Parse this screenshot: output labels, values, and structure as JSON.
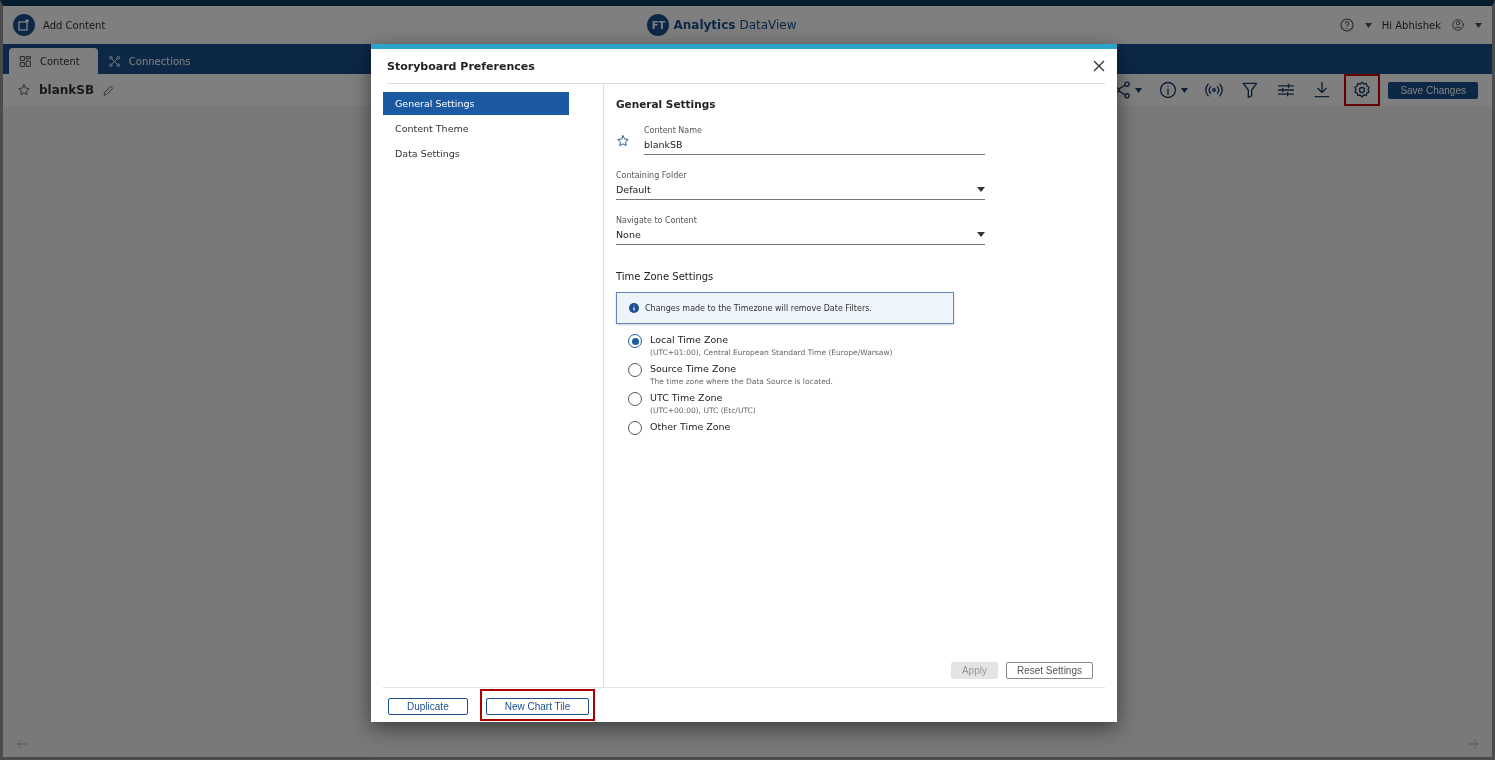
{
  "header": {
    "add_content": "Add Content",
    "logo_badge": "FT",
    "logo_text": "Analytics",
    "logo_suffix": "DataView",
    "greeting": "Hi Abhishek"
  },
  "tabs": [
    {
      "label": "Content",
      "selected": true
    },
    {
      "label": "Connections",
      "selected": false
    }
  ],
  "storyboard": {
    "name": "blankSB",
    "settings_highlighted": true,
    "save_button": "Save Changes"
  },
  "dialog": {
    "title": "Storyboard Preferences",
    "nav": [
      {
        "label": "General Settings",
        "selected": true
      },
      {
        "label": "Content Theme",
        "selected": false
      },
      {
        "label": "Data Settings",
        "selected": false
      }
    ],
    "heading": "General Settings",
    "fields": [
      {
        "kind": "text",
        "label": "Content Name",
        "value": "blankSB"
      },
      {
        "kind": "select",
        "label": "Containing Folder",
        "value": "Default"
      },
      {
        "kind": "select",
        "label": "Navigate to Content",
        "value": "None"
      }
    ],
    "timezone_heading": "Time Zone Settings",
    "notice": "Changes made to the Timezone will remove Date Filters.",
    "timezones": [
      {
        "label": "Local Time Zone",
        "description": "(UTC+01:00), Central European Standard Time (Europe/Warsaw)",
        "selected": true
      },
      {
        "label": "Source Time Zone",
        "description": "The time zone where the Data Source is located.",
        "selected": false
      },
      {
        "label": "UTC Time Zone",
        "description": "(UTC+00:00), UTC (Etc/UTC)",
        "selected": false
      },
      {
        "label": "Other Time Zone",
        "selected": false
      }
    ],
    "apply": {
      "label": "Apply",
      "disabled": true
    },
    "reset": "Reset Settings",
    "footer_buttons": [
      {
        "label": "Duplicate",
        "highlighted": false
      },
      {
        "label": "New Chart Tile",
        "highlighted": true
      }
    ]
  }
}
